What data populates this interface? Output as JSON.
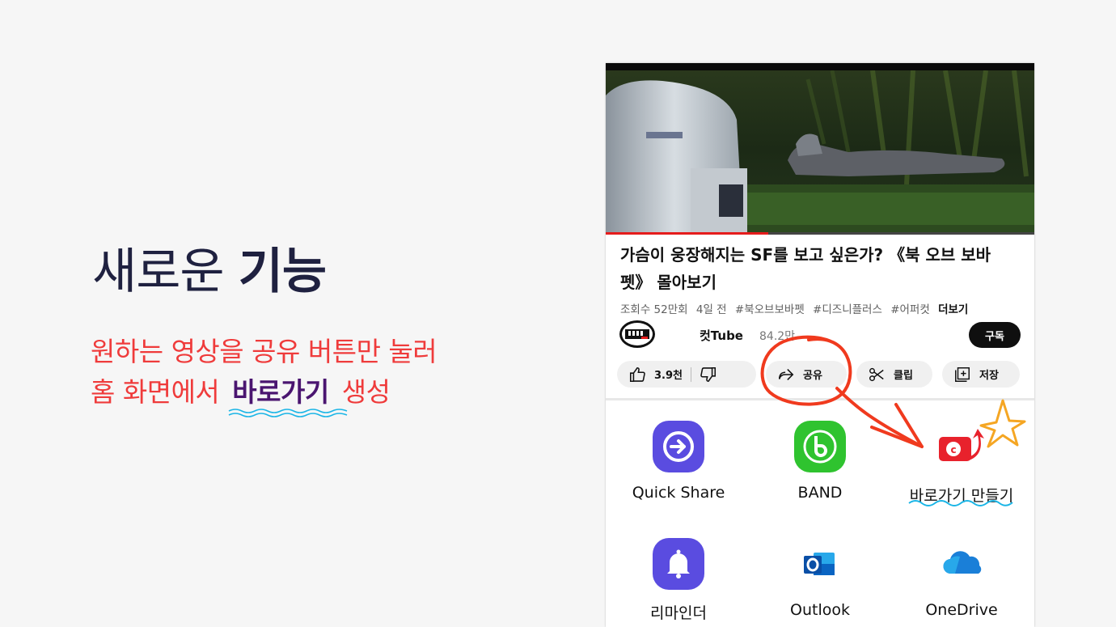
{
  "headline": {
    "regular": "새로운 ",
    "bold": "기능"
  },
  "description": {
    "line1": "원하는 영상을 공유 버튼만 눌러",
    "line2_before": "홈 화면에서 ",
    "line2_highlight": "바로가기",
    "line2_after": " 생성"
  },
  "video": {
    "progress": 0.38,
    "title": "가슴이 웅장해지는 SF를 보고 싶은가? 《북 오브 보바 펫》 몰아보기",
    "views": "조회수 52만회",
    "age": "4일 전",
    "tags": [
      "#북오브보바펫",
      "#디즈니플러스",
      "#어퍼컷"
    ],
    "more_label": "더보기"
  },
  "channel": {
    "name": "컷Tube",
    "subscribers": "84.2만",
    "subscribe_label": "구독"
  },
  "actions": {
    "like_count": "3.9천",
    "share_label": "공유",
    "clip_label": "클립",
    "save_label": "저장"
  },
  "share_targets": [
    {
      "label": "Quick Share",
      "icon": "quick-share-icon",
      "color": "#5a4ce0"
    },
    {
      "label": "BAND",
      "icon": "band-icon",
      "color": "#2fc32f"
    },
    {
      "label": "바로가기 만들기",
      "icon": "shortcut-icon",
      "color": "#e8222c"
    },
    {
      "label": "리마인더",
      "icon": "bell-icon",
      "color": "#5a4ce0"
    },
    {
      "label": "Outlook",
      "icon": "outlook-icon",
      "color": "#0a64c2"
    },
    {
      "label": "OneDrive",
      "icon": "onedrive-icon",
      "color": "#1a7fd8"
    }
  ],
  "colors": {
    "accent_red": "#ef3b3b",
    "headline": "#1f2140",
    "highlight": "#4a1570",
    "annotation_red": "#f03a1e",
    "star": "#f5a623",
    "squiggle": "#1ab5e6"
  }
}
